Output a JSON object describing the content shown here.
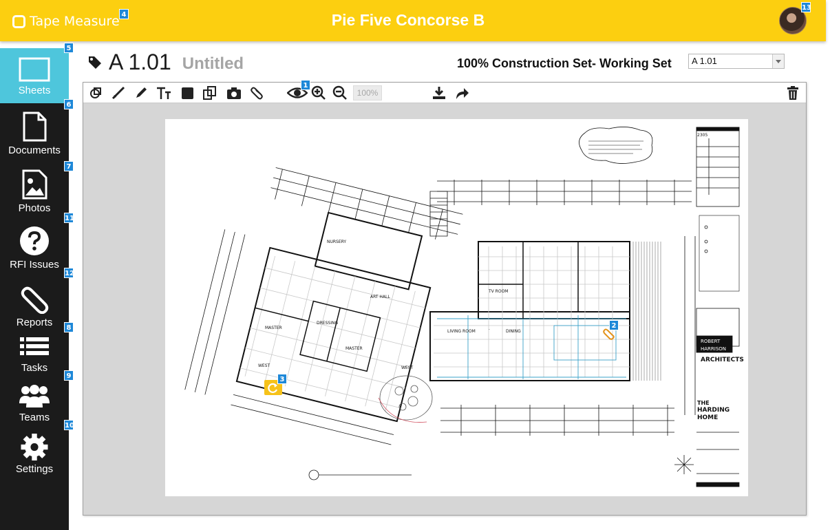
{
  "app": {
    "brand": "Tape Measure",
    "title": "Pie Five Concorse B"
  },
  "badges": {
    "brand": "4",
    "avatar": "13",
    "sheets": "5",
    "documents": "6",
    "photos": "7",
    "rfi": "11",
    "reports": "12",
    "tasks": "8",
    "teams": "9",
    "settings": "10",
    "eye_tool": "1",
    "pin_2": "2",
    "pin_3": "3"
  },
  "sidebar": {
    "items": [
      {
        "label": "Sheets",
        "icon": "sheets-icon"
      },
      {
        "label": "Documents",
        "icon": "document-icon"
      },
      {
        "label": "Photos",
        "icon": "photo-icon"
      },
      {
        "label": "RFI Issues",
        "icon": "question-icon"
      },
      {
        "label": "Reports",
        "icon": "paperclip-icon"
      },
      {
        "label": "Tasks",
        "icon": "list-icon"
      },
      {
        "label": "Teams",
        "icon": "people-icon"
      },
      {
        "label": "Settings",
        "icon": "gear-icon"
      }
    ]
  },
  "header": {
    "sheet_number": "A 1.01",
    "sheet_name": "Untitled",
    "set_label": "100% Construction Set- Working Set",
    "select_value": "A 1.01"
  },
  "toolbar": {
    "zoom": "100%",
    "tools": [
      "shapes-icon",
      "line-icon",
      "pencil-icon",
      "text-icon",
      "fill-icon",
      "copy-icon",
      "camera-icon",
      "attach-icon",
      "eye-icon",
      "zoom-in-icon",
      "zoom-out-icon",
      "download-icon",
      "share-icon",
      "trash-icon"
    ]
  },
  "colors": {
    "topbar": "#fccf10",
    "sidebar": "#1b1b1b",
    "active_nav": "#4ec6dc",
    "badge": "#1e88d8"
  }
}
